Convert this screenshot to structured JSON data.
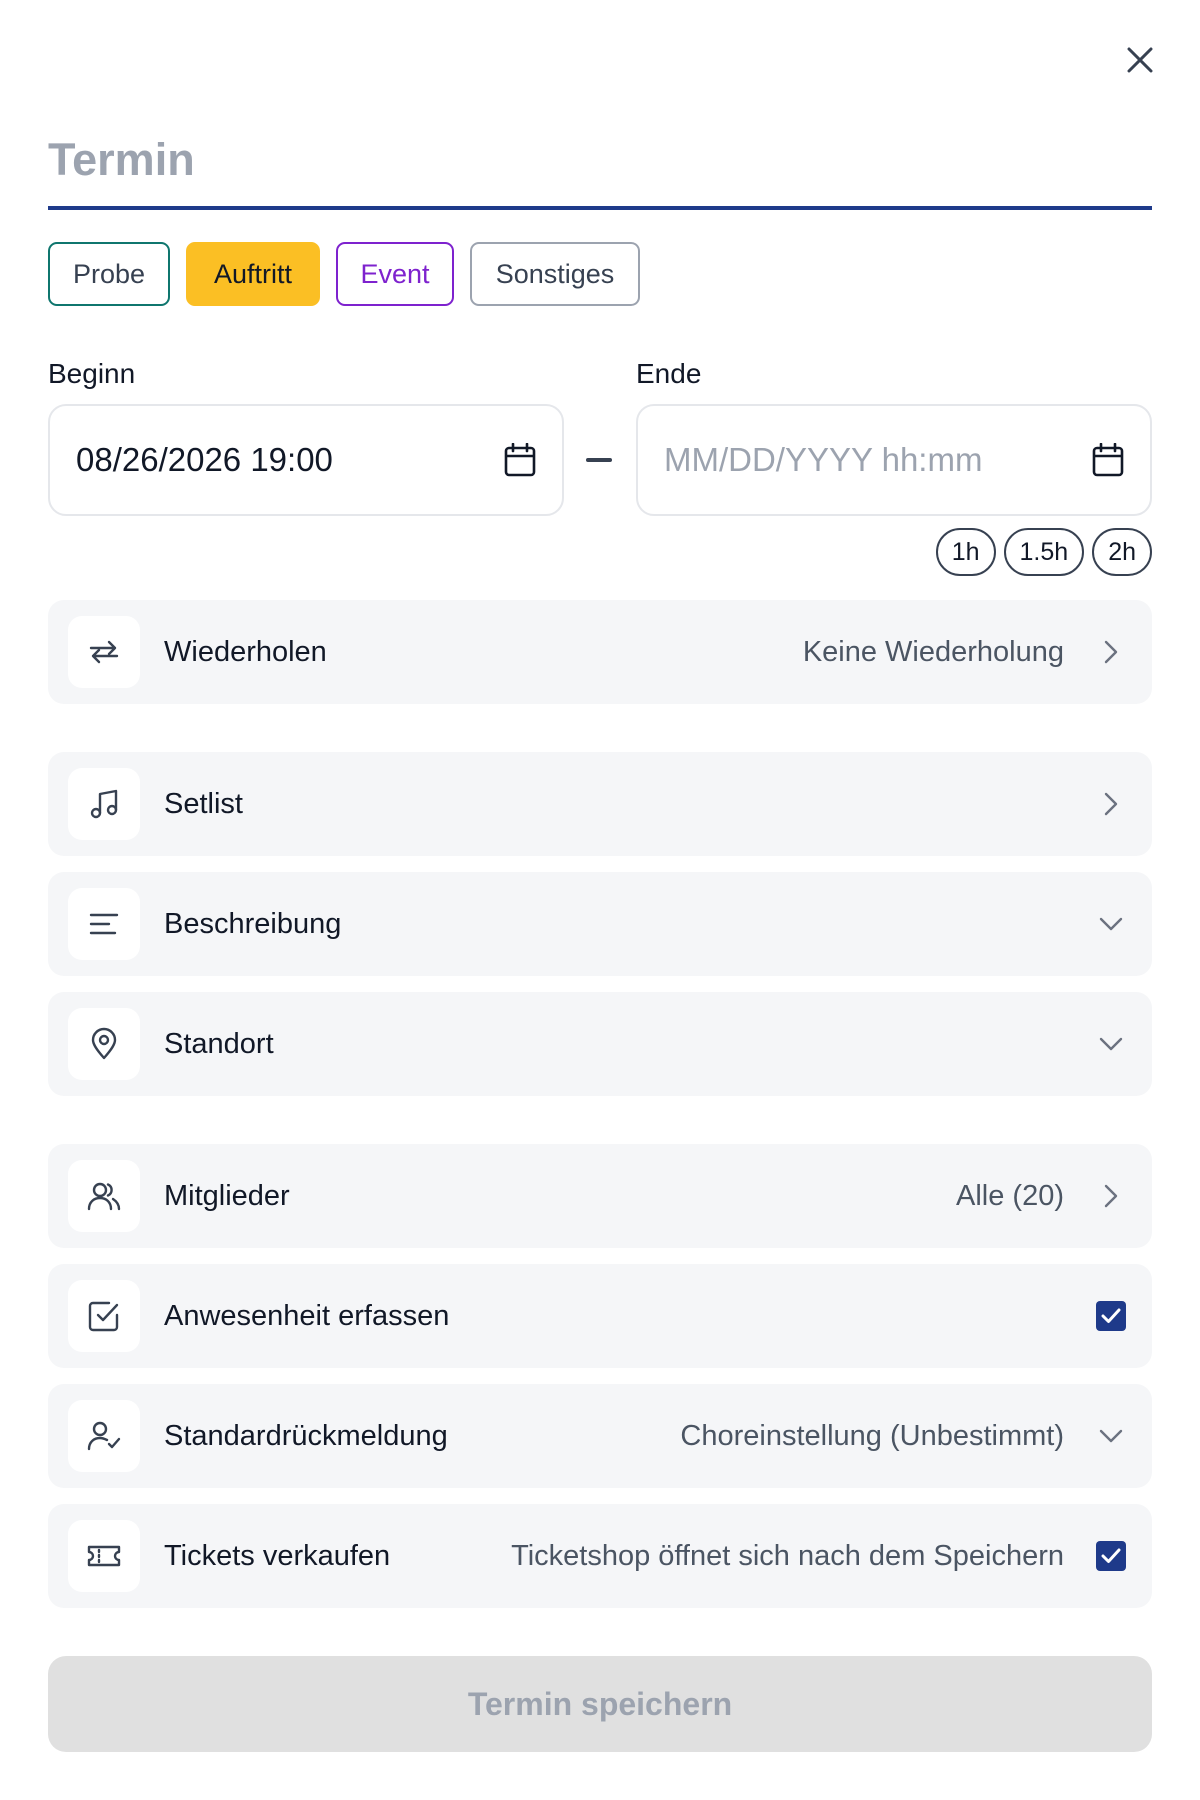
{
  "title": {
    "placeholder": "Termin"
  },
  "types": [
    {
      "label": "Probe"
    },
    {
      "label": "Auftritt"
    },
    {
      "label": "Event"
    },
    {
      "label": "Sonstiges"
    }
  ],
  "start": {
    "label": "Beginn",
    "value": "08/26/2026 19:00"
  },
  "end": {
    "label": "Ende",
    "placeholder": "MM/DD/YYYY hh:mm"
  },
  "durations": [
    "1h",
    "1.5h",
    "2h"
  ],
  "rows": {
    "repeat": {
      "label": "Wiederholen",
      "value": "Keine Wiederholung"
    },
    "setlist": {
      "label": "Setlist"
    },
    "description": {
      "label": "Beschreibung"
    },
    "location": {
      "label": "Standort"
    },
    "members": {
      "label": "Mitglieder",
      "value": "Alle (20)"
    },
    "attendance": {
      "label": "Anwesenheit erfassen",
      "checked": true
    },
    "default_response": {
      "label": "Standardrückmeldung",
      "value": "Choreinstellung (Unbestimmt)"
    },
    "tickets": {
      "label": "Tickets verkaufen",
      "value": "Ticketshop öffnet sich nach dem Speichern",
      "checked": true
    }
  },
  "save_button": {
    "label": "Termin speichern"
  },
  "colors": {
    "accent": "#1e3a8a",
    "probe": "#0f766e",
    "auftritt": "#fbbf24",
    "event": "#7e22ce",
    "row_bg": "#f5f6f8"
  }
}
